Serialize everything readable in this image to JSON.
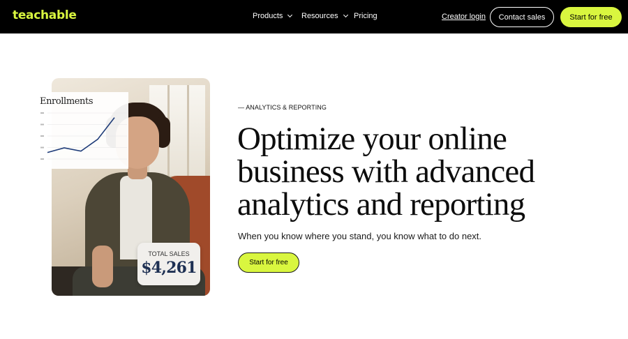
{
  "nav": {
    "logo": "teachable",
    "items": [
      {
        "label": "Products",
        "has_dropdown": true
      },
      {
        "label": "Resources",
        "has_dropdown": true
      },
      {
        "label": "Pricing",
        "has_dropdown": false
      }
    ],
    "login": "Creator login",
    "contact": "Contact sales",
    "cta": "Start for free"
  },
  "hero": {
    "eyebrow": "— ANALYTICS & REPORTING",
    "headline": "Optimize your online business with advanced analytics and reporting",
    "subtext": "When you know where you stand, you know what to do next.",
    "cta": "Start for free"
  },
  "image": {
    "enrollments": {
      "title": "Enrollments",
      "values": [
        40,
        47,
        42,
        60,
        93
      ]
    },
    "sales": {
      "label": "TOTAL SALES",
      "value": "$4,261"
    }
  },
  "colors": {
    "accent": "#d9f63f",
    "nav_bg": "#000000",
    "chart_line": "#1d3b78",
    "sales_value": "#1d2f52"
  },
  "icons": [
    "chevron-down-icon"
  ]
}
